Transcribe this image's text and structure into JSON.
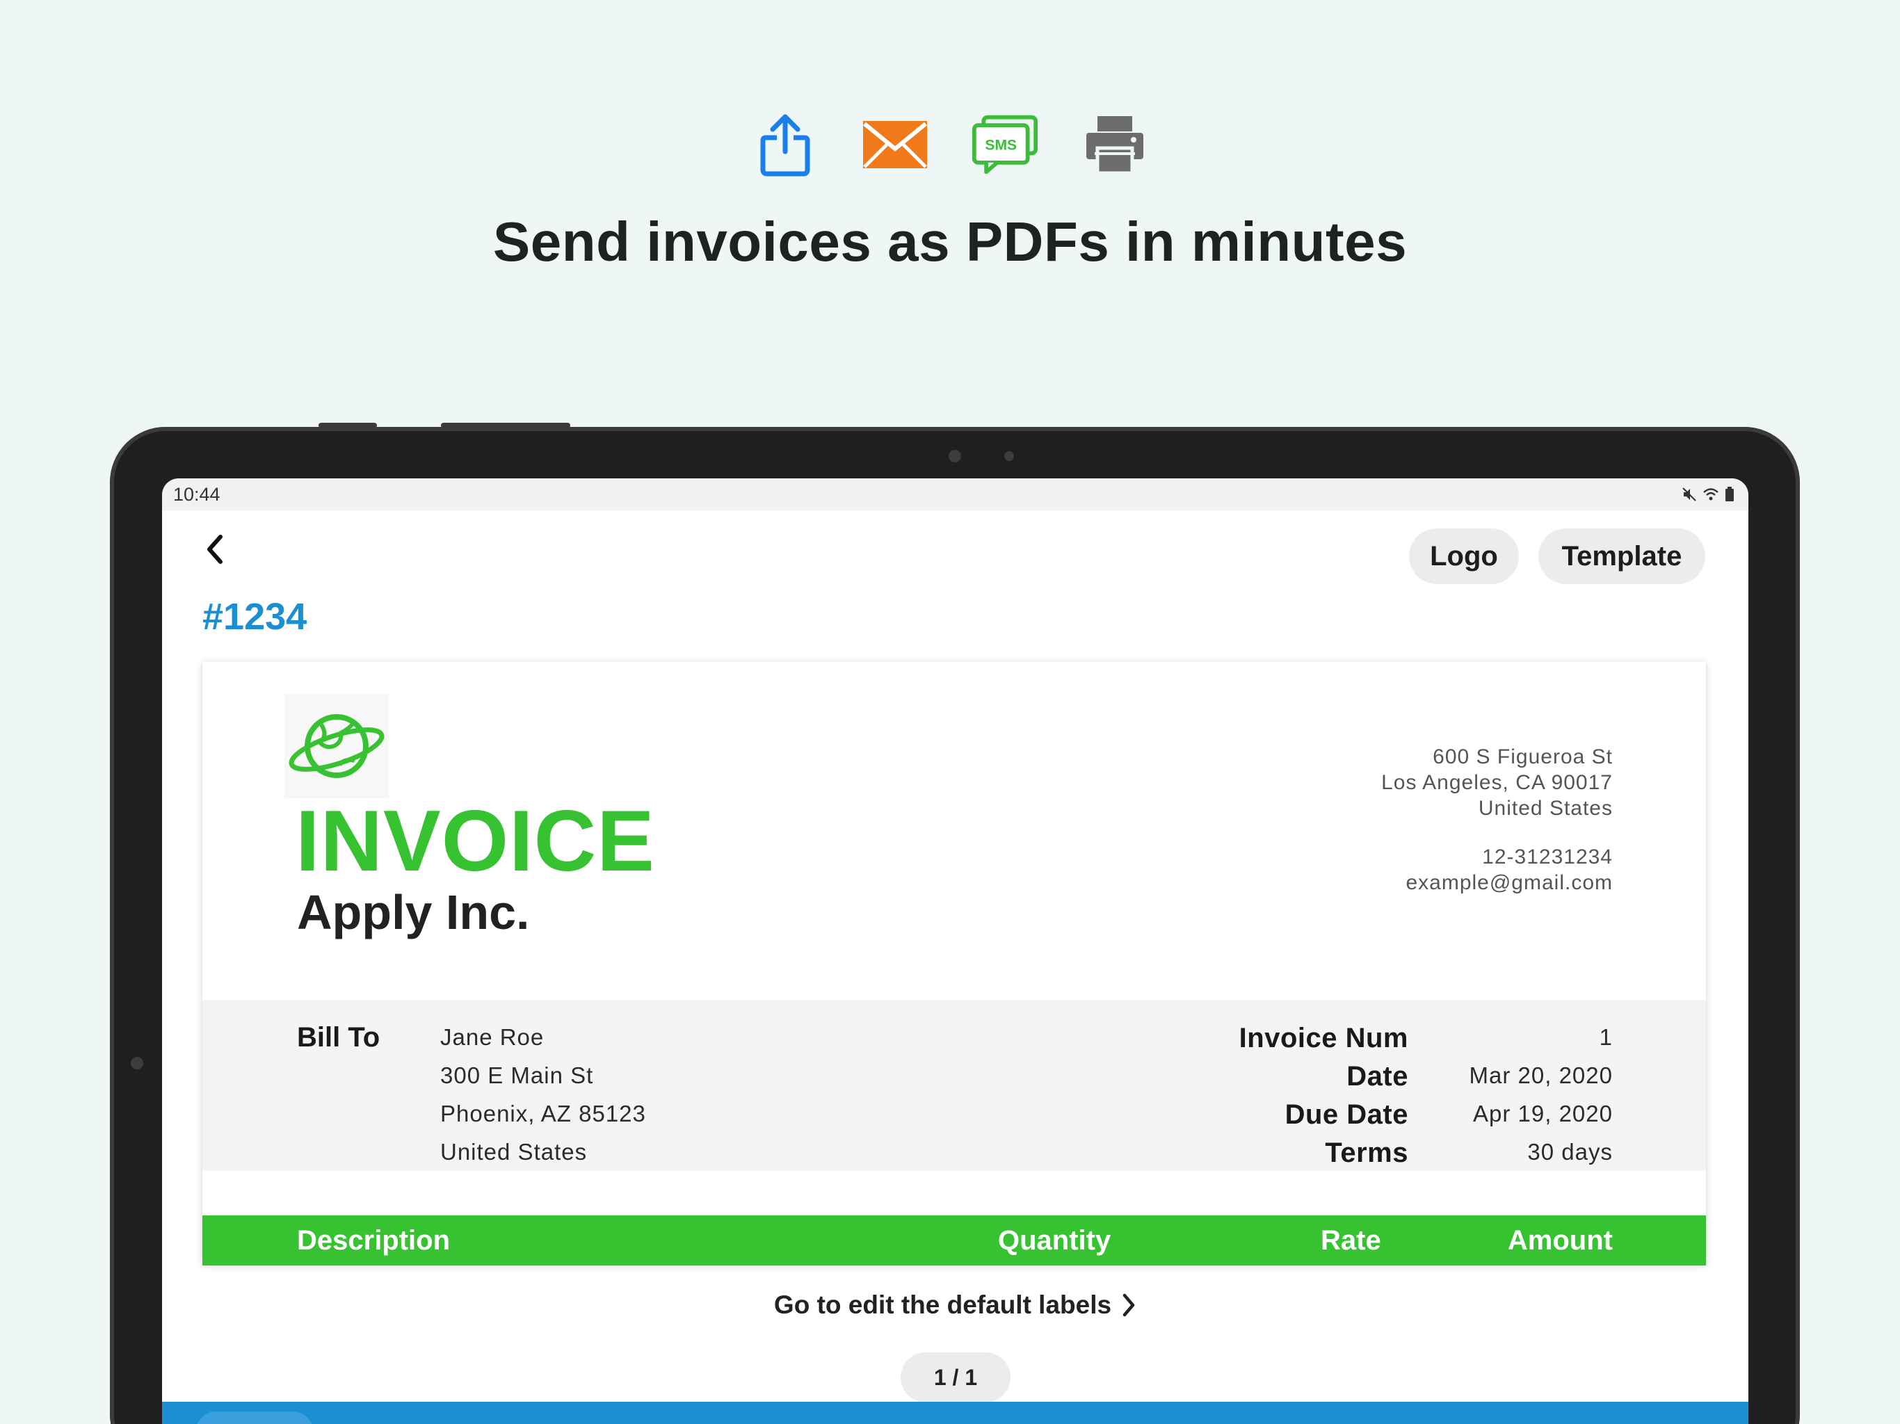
{
  "promo": {
    "headline": "Send invoices as PDFs in minutes",
    "icons": [
      "share-icon",
      "email-icon",
      "sms-icon",
      "printer-icon"
    ],
    "sms_text": "SMS",
    "colors": {
      "share": "#1a7fe8",
      "email": "#f07a1a",
      "sms": "#3dbb3a",
      "printer": "#6d6d6d"
    }
  },
  "status_bar": {
    "time": "10:44"
  },
  "app_bar": {
    "logo_label": "Logo",
    "template_label": "Template"
  },
  "invoice_number": "#1234",
  "invoice": {
    "title": "INVOICE",
    "company": "Apply Inc.",
    "from_address": [
      "600 S Figueroa St",
      "Los Angeles, CA 90017",
      "United States"
    ],
    "from_phone": "12-31231234",
    "from_email": "example@gmail.com",
    "bill_to_label": "Bill To",
    "bill_to": [
      "Jane Roe",
      "300 E Main St",
      "Phoenix, AZ 85123",
      "United States"
    ],
    "meta": [
      {
        "label": "Invoice Num",
        "value": "1"
      },
      {
        "label": "Date",
        "value": "Mar 20, 2020"
      },
      {
        "label": "Due Date",
        "value": "Apr 19, 2020"
      },
      {
        "label": "Terms",
        "value": "30 days"
      }
    ],
    "columns": {
      "description": "Description",
      "quantity": "Quantity",
      "rate": "Rate",
      "amount": "Amount"
    },
    "accent": "#37c231"
  },
  "edit_labels_link": "Go to edit the default labels",
  "pager": "1 / 1",
  "colors": {
    "primary": "#1b8fd2",
    "invoice_green": "#37c231",
    "background": "#eef6f6"
  }
}
